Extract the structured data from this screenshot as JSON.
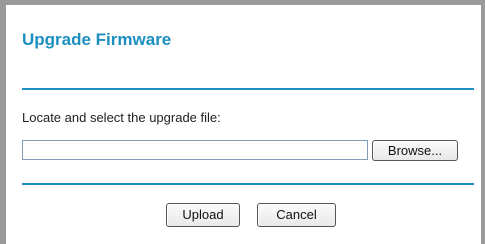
{
  "page": {
    "title": "Upgrade Firmware"
  },
  "form": {
    "instruction": "Locate and select the upgrade file:",
    "file_value": "",
    "browse_label": "Browse...",
    "upload_label": "Upload",
    "cancel_label": "Cancel"
  },
  "colors": {
    "accent": "#1c8fc0",
    "frame_border": "#9a9a9a"
  }
}
